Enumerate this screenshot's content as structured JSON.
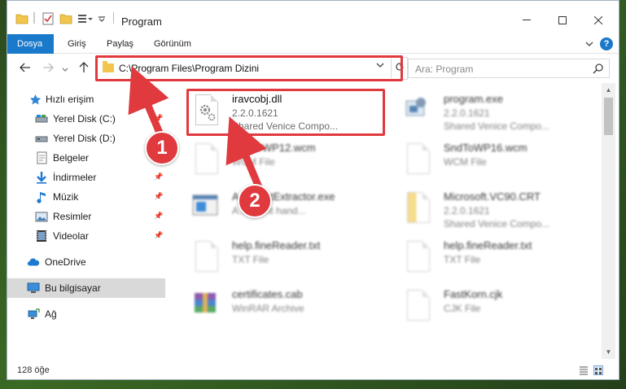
{
  "window": {
    "title": "Program"
  },
  "ribbon": {
    "tabs": [
      "Dosya",
      "Giriş",
      "Paylaş",
      "Görünüm"
    ],
    "help_label": "?"
  },
  "address": {
    "path": "C:\\Program Files\\Program Dizini",
    "search_placeholder": "Ara: Program"
  },
  "sidebar": {
    "items": [
      {
        "label": "Hızlı erişim",
        "icon": "star-icon"
      },
      {
        "label": "Yerel Disk (C:)",
        "icon": "drive-icon"
      },
      {
        "label": "Yerel Disk (D:)",
        "icon": "drive-icon"
      },
      {
        "label": "Belgeler",
        "icon": "documents-icon"
      },
      {
        "label": "İndirmeler",
        "icon": "download-icon"
      },
      {
        "label": "Müzik",
        "icon": "music-icon"
      },
      {
        "label": "Resimler",
        "icon": "pictures-icon"
      },
      {
        "label": "Videolar",
        "icon": "video-icon"
      },
      {
        "label": "OneDrive",
        "icon": "cloud-icon"
      },
      {
        "label": "Bu bilgisayar",
        "icon": "computer-icon"
      },
      {
        "label": "Ağ",
        "icon": "network-icon"
      }
    ]
  },
  "files": [
    {
      "name": "iravcobj.dll",
      "line1": "2.2.0.1621",
      "line2": "Shared Venice Compo...",
      "icon": "dll-gear-icon"
    },
    {
      "name": "program.exe",
      "line1": "2.2.0.1621",
      "line2": "Shared Venice Compo...",
      "icon": "exe-icon"
    },
    {
      "name": "SndToWP12.wcm",
      "line1": "WCM File",
      "line2": "",
      "icon": "document-icon"
    },
    {
      "name": "SndToWP16.wcm",
      "line1": "WCM File",
      "line2": "",
      "icon": "document-icon"
    },
    {
      "name": "AcroTextExtractor.exe",
      "line1": "A... event hand...",
      "line2": "",
      "icon": "app-window-icon"
    },
    {
      "name": "Microsoft.VC90.CRT",
      "line1": "2.2.0.1621",
      "line2": "Shared Venice Compo...",
      "icon": "manifest-icon"
    },
    {
      "name": "help.fineReader.txt",
      "line1": "TXT File",
      "line2": "",
      "icon": "document-icon"
    },
    {
      "name": "help.fineReader.txt",
      "line1": "TXT File",
      "line2": "",
      "icon": "document-icon"
    },
    {
      "name": "certificates.cab",
      "line1": "WinRAR Archive",
      "line2": "",
      "icon": "archive-icon"
    },
    {
      "name": "FastKorn.cjk",
      "line1": "CJK File",
      "line2": "",
      "icon": "document-icon"
    }
  ],
  "status": {
    "item_count": "128 öğe"
  },
  "annotations": {
    "badge1": "1",
    "badge2": "2",
    "color": "#e0393e"
  }
}
